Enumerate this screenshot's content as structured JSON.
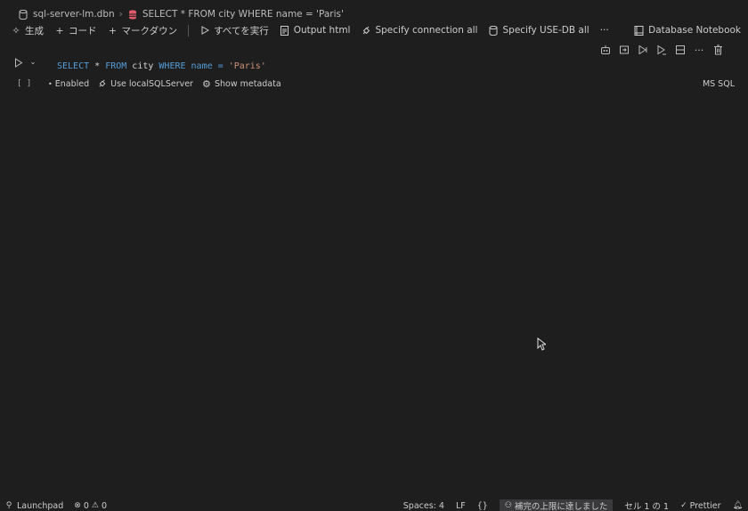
{
  "breadcrumb": {
    "file": "sql-server-lm.dbn",
    "cell": "SELECT * FROM city WHERE name = 'Paris'"
  },
  "toolbar": {
    "generate": "生成",
    "code": "コード",
    "markdown": "マークダウン",
    "run_all": "すべてを実行",
    "output_html": "Output html",
    "specify_connection": "Specify connection all",
    "specify_use_db": "Specify USE-DB all",
    "more": "···",
    "kernel": "Database Notebook"
  },
  "cell": {
    "execution_count": "[ ]",
    "code_tokens": [
      "SELECT",
      " * ",
      "FROM",
      " city ",
      "WHERE",
      " name = ",
      "'Paris'"
    ],
    "status": {
      "enabled": "Enabled",
      "connection": "Use localSQLServer",
      "metadata": "Show metadata"
    },
    "language": "MS SQL"
  },
  "statusbar": {
    "launchpad": "Launchpad",
    "errors": "0",
    "warnings": "0",
    "spaces": "Spaces: 4",
    "eol": "LF",
    "braces": "{}",
    "limit": "補完の上限に達しました",
    "cell_pos": "セル 1 の 1",
    "prettier": "Prettier"
  },
  "colors": {
    "background": "#1e1e1f",
    "keyword": "#569cd6",
    "string": "#ce9178",
    "db_icon": "#e05a6a"
  }
}
